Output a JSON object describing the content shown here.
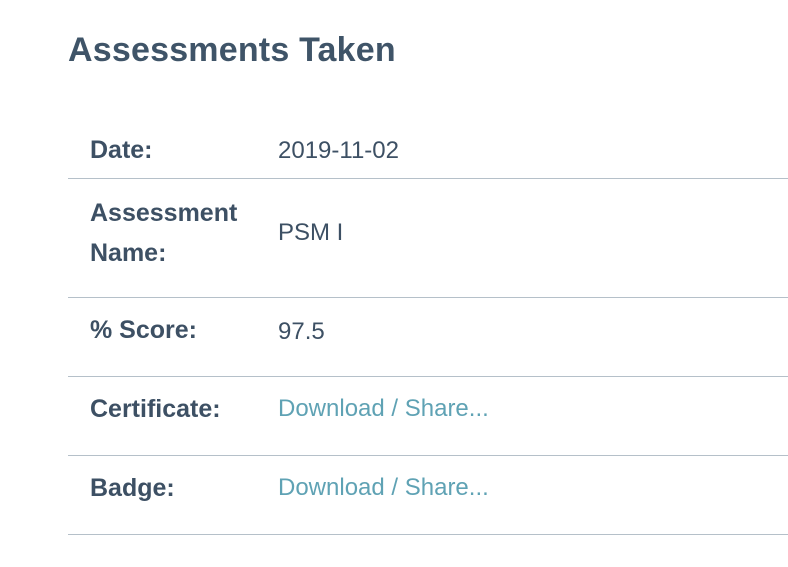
{
  "title": "Assessments Taken",
  "details": {
    "date": {
      "label": "Date:",
      "value": "2019-11-02"
    },
    "assessment_name": {
      "label_line1": "Assessment",
      "label_line2": "Name:",
      "value": "PSM I"
    },
    "score": {
      "label": "% Score:",
      "value": "97.5"
    },
    "certificate": {
      "label": "Certificate:",
      "link": "Download / Share..."
    },
    "badge": {
      "label": "Badge:",
      "link": "Download / Share..."
    }
  },
  "colors": {
    "text": "#3d5064",
    "link": "#5fa2b4",
    "divider": "#b5c0c9"
  }
}
